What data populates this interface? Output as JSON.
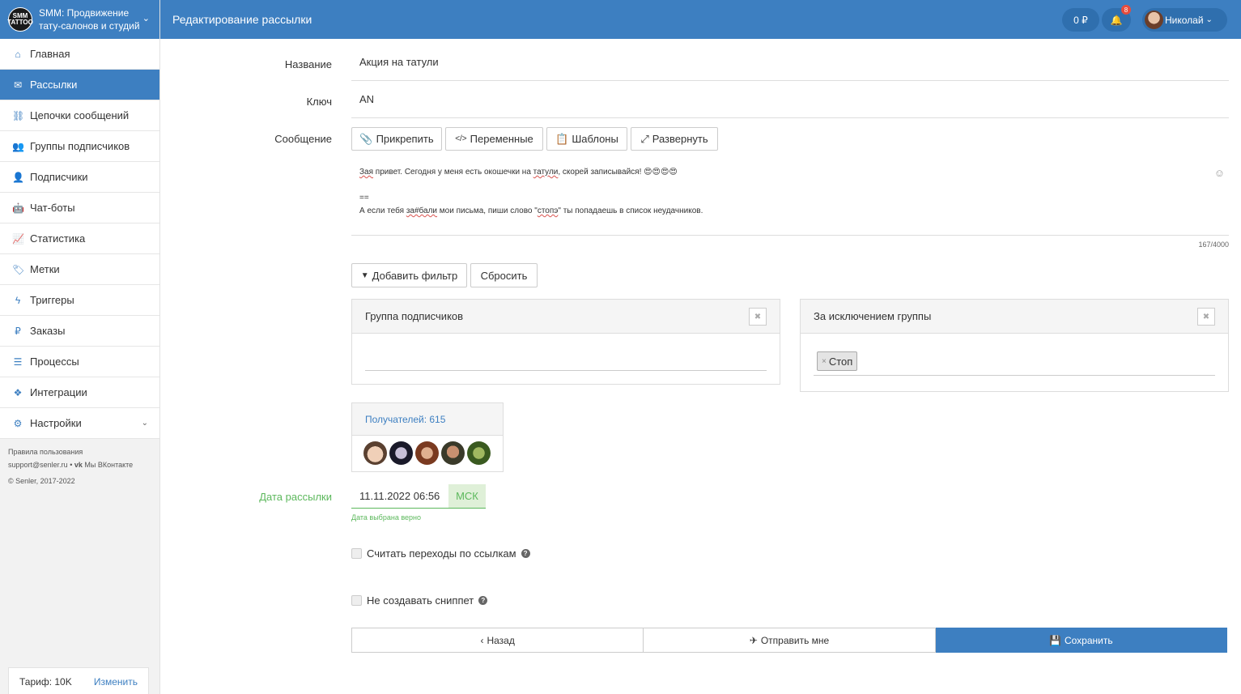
{
  "brand": {
    "logo_text": "SMM TATTOO",
    "title": "SMM: Продвижение тату-салонов и студий"
  },
  "topbar": {
    "title": "Редактирование рассылки",
    "balance": "0 ₽",
    "notifications_count": "8",
    "user_name": "Николай"
  },
  "sidebar": {
    "items": [
      {
        "label": "Главная",
        "icon": "home-icon"
      },
      {
        "label": "Рассылки",
        "icon": "envelope-icon",
        "active": true
      },
      {
        "label": "Цепочки сообщений",
        "icon": "link-icon"
      },
      {
        "label": "Группы подписчиков",
        "icon": "users-icon"
      },
      {
        "label": "Подписчики",
        "icon": "user-icon"
      },
      {
        "label": "Чат-боты",
        "icon": "android-icon"
      },
      {
        "label": "Статистика",
        "icon": "line-chart-icon"
      },
      {
        "label": "Метки",
        "icon": "tag-icon"
      },
      {
        "label": "Триггеры",
        "icon": "bolt-icon"
      },
      {
        "label": "Заказы",
        "icon": "ruble-icon"
      },
      {
        "label": "Процессы",
        "icon": "list-icon"
      },
      {
        "label": "Интеграции",
        "icon": "cubes-icon"
      },
      {
        "label": "Настройки",
        "icon": "cogs-icon"
      }
    ],
    "footer": {
      "terms": "Правила пользования",
      "support": "support@senler.ru",
      "vk": "Мы ВКонтакте",
      "copyright": "© Senler, 2017-2022"
    },
    "tariff": {
      "label": "Тариф: 10K",
      "change": "Изменить"
    }
  },
  "form": {
    "name_label": "Название",
    "name_value": "Акция на татули",
    "key_label": "Ключ",
    "key_value": "AN",
    "message_label": "Сообщение",
    "toolbar": {
      "attach": "Прикрепить",
      "variables": "Переменные",
      "templates": "Шаблоны",
      "expand": "Развернуть"
    },
    "message": {
      "line1_a": "Зая",
      "line1_b": " привет. Сегодня у меня есть окошечки на ",
      "line1_c": "татули",
      "line1_d": ", скорей записывайся! 😍😍😍😍",
      "line2": "==",
      "line3_a": "А если тебя ",
      "line3_b": "за#бали",
      "line3_c": " мои письма, пиши слово \"",
      "line3_d": "стопэ",
      "line3_e": "\" ты попадаешь в список неудачников."
    },
    "counter": "167/4000",
    "add_filter": "Добавить фильтр",
    "reset": "Сбросить",
    "group_panel_title": "Группа подписчиков",
    "except_panel_title": "За исключением группы",
    "except_tag": "Стоп",
    "recipients": "Получателей: 615",
    "date_label": "Дата рассылки",
    "date_value": "11.11.2022 06:56",
    "timezone": "МСК",
    "date_hint": "Дата выбрана верно",
    "count_clicks": "Считать переходы по ссылкам",
    "no_snippet": "Не создавать сниппет",
    "back": "Назад",
    "send_me": "Отправить мне",
    "save": "Сохранить"
  }
}
